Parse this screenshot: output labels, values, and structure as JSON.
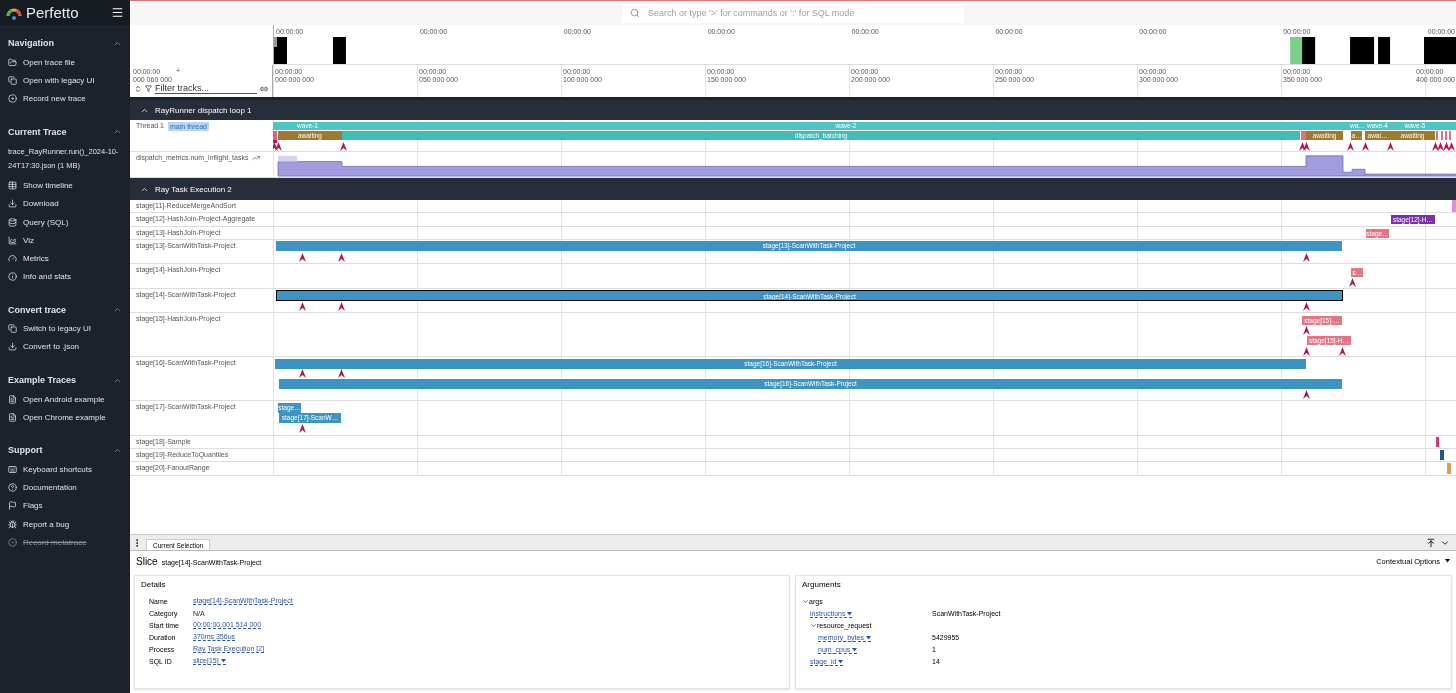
{
  "sidebar": {
    "brand": "Perfetto",
    "trace_file": "trace_RayRunner.run()_2024-10-24T17:30.json (1 MB)",
    "sections": [
      {
        "title": "Navigation",
        "expanded": true,
        "items": [
          {
            "label": "Open trace file",
            "disabled": false
          },
          {
            "label": "Open with legacy UI",
            "disabled": false
          },
          {
            "label": "Record new trace",
            "disabled": false
          }
        ]
      },
      {
        "title": "Current Trace",
        "expanded": true,
        "items": [
          {
            "label": "Show timeline",
            "disabled": false
          },
          {
            "label": "Download",
            "disabled": false
          },
          {
            "label": "Query (SQL)",
            "disabled": false
          },
          {
            "label": "Viz",
            "disabled": false
          },
          {
            "label": "Metrics",
            "disabled": false
          },
          {
            "label": "Info and stats",
            "disabled": false
          }
        ]
      },
      {
        "title": "Convert trace",
        "expanded": true,
        "items": [
          {
            "label": "Switch to legacy UI",
            "disabled": false
          },
          {
            "label": "Convert to .json",
            "disabled": false
          }
        ]
      },
      {
        "title": "Example Traces",
        "expanded": true,
        "items": [
          {
            "label": "Open Android example",
            "disabled": false
          },
          {
            "label": "Open Chrome example",
            "disabled": false
          }
        ]
      },
      {
        "title": "Support",
        "expanded": true,
        "items": [
          {
            "label": "Keyboard shortcuts",
            "disabled": false
          },
          {
            "label": "Documentation",
            "disabled": false
          },
          {
            "label": "Flags",
            "disabled": false
          },
          {
            "label": "Report a bug",
            "disabled": false
          },
          {
            "label": "Record metatrace",
            "disabled": true
          }
        ]
      }
    ]
  },
  "search": {
    "placeholder": "Search or type '>' for commands or ':' for SQL mode"
  },
  "overview": {
    "tick_labels": [
      "00:00:00",
      "00:00:00",
      "00:00:00",
      "00:00:00",
      "00:00:00",
      "00:00:00",
      "00:00:00",
      "00:00:00",
      "00:00:00"
    ]
  },
  "ruler": {
    "origin": [
      "00:00:00",
      "000 060 000"
    ],
    "origin_mark": "+",
    "ticks": [
      {
        "time": "00:00:00",
        "offset": "000 000 000"
      },
      {
        "time": "00:00:00",
        "offset": "050 000 000"
      },
      {
        "time": "00:00:00",
        "offset": "100 000 000"
      },
      {
        "time": "00:00:00",
        "offset": "150 000 000"
      },
      {
        "time": "00:00:00",
        "offset": "200 000 000"
      },
      {
        "time": "00:00:00",
        "offset": "250 000 000"
      },
      {
        "time": "00:00:00",
        "offset": "300 000 000"
      },
      {
        "time": "00:00:00",
        "offset": "350 000 000"
      },
      {
        "time": "00:00:00",
        "offset": "400 000 000"
      }
    ]
  },
  "filter": {
    "placeholder": "Filter tracks..."
  },
  "groups": [
    {
      "title": "RayRunner dispatch loop 1",
      "expanded": true,
      "tracks": [
        {
          "kind": "thread",
          "name": "Thread 1",
          "tag": "main thread",
          "slices": [
            {
              "label": "wave-1",
              "color": "#4fc4c4",
              "selected": false
            },
            {
              "label": "wave-2",
              "color": "#4fc4c4",
              "selected": false
            },
            {
              "label": "wa…",
              "color": "#4fc4c4",
              "selected": false
            },
            {
              "label": "wave-4",
              "color": "#4fc4c4",
              "selected": false
            },
            {
              "label": "wave-5",
              "color": "#4fc4c4",
              "selected": false
            },
            {
              "label": "awaiting",
              "color": "#9c7a30",
              "selected": false
            },
            {
              "label": "dispatch_batching",
              "color": "#41bcb6",
              "selected": false
            },
            {
              "label": "awaiting",
              "color": "#9c7a30",
              "selected": false
            },
            {
              "label": "a…",
              "color": "#9c7a30",
              "selected": false
            },
            {
              "label": "awai…",
              "color": "#9c7a30",
              "selected": false
            },
            {
              "label": "awaiting",
              "color": "#9c7a30",
              "selected": false
            }
          ]
        },
        {
          "kind": "counter",
          "name": "dispatch_metrics.num_inflight_tasks"
        }
      ]
    },
    {
      "title": "Ray Task Execution 2",
      "expanded": true,
      "tracks": [
        {
          "kind": "slices",
          "name": "stage[11]-ReduceMergeAndSort"
        },
        {
          "kind": "slices",
          "name": "stage[12]-HashJoin-Project-Aggregate",
          "slices": [
            {
              "label": "stage[12]-H…",
              "color": "#7b2fa8",
              "selected": false
            }
          ]
        },
        {
          "kind": "slices",
          "name": "stage[13]-HashJoin-Project",
          "slices": [
            {
              "label": "stage…",
              "color": "#e57480",
              "selected": false
            }
          ]
        },
        {
          "kind": "slices",
          "name": "stage[13]-ScanWithTask-Project",
          "slices": [
            {
              "label": "stage[13]-ScanWithTask-Project",
              "color": "#3b94c4",
              "selected": false
            }
          ]
        },
        {
          "kind": "slices",
          "name": "stage[14]-HashJoin-Project",
          "slices": [
            {
              "label": "s…",
              "color": "#e57480",
              "selected": false
            }
          ]
        },
        {
          "kind": "slices",
          "name": "stage[14]-ScanWithTask-Project",
          "slices": [
            {
              "label": "stage[14]-ScanWithTask-Project",
              "color": "#3b94c4",
              "selected": true
            }
          ]
        },
        {
          "kind": "slices",
          "name": "stage[15]-HashJoin-Project",
          "slices": [
            {
              "label": "stage[15]-…",
              "color": "#e57480",
              "selected": false
            },
            {
              "label": "stage[15]-H…",
              "color": "#e57480",
              "selected": false
            }
          ]
        },
        {
          "kind": "slices",
          "name": "stage[16]-ScanWithTask-Project",
          "slices": [
            {
              "label": "stage[16]-ScanWithTask-Project",
              "color": "#3b94c4",
              "selected": false
            },
            {
              "label": "stage[16]-ScanWithTask-Project",
              "color": "#3b94c4",
              "selected": false
            }
          ]
        },
        {
          "kind": "slices",
          "name": "stage[17]-ScanWithTask-Project",
          "slices": [
            {
              "label": "stage…",
              "color": "#3b94c4",
              "selected": false
            },
            {
              "label": "stage[17]-ScanW…",
              "color": "#3b94c4",
              "selected": false
            }
          ]
        },
        {
          "kind": "slices",
          "name": "stage[18]-Sample"
        },
        {
          "kind": "slices",
          "name": "stage[19]-ReduceToQuantiles"
        },
        {
          "kind": "slices",
          "name": "stage[20]-FanoutRange"
        }
      ]
    }
  ],
  "bottom": {
    "tabs": [
      {
        "label": "Current Selection",
        "selected": true
      }
    ],
    "selection": {
      "type": "Slice",
      "name": "stage[14]-ScanWithTask-Project"
    },
    "contextual": "Contextual Options",
    "details": {
      "title": "Details",
      "rows": [
        {
          "key": "Name",
          "value": "stage[14]-ScanWithTask-Project",
          "link": true,
          "menu": false
        },
        {
          "key": "Category",
          "value": "N/A",
          "link": false,
          "menu": false
        },
        {
          "key": "Start time",
          "value": "00:00:00.001 514 000",
          "link": true,
          "menu": false
        },
        {
          "key": "Duration",
          "value": "370ms 356us",
          "link": true,
          "menu": false
        },
        {
          "key": "Process",
          "value": "Ray Task Execution [2]",
          "link": true,
          "menu": false
        },
        {
          "key": "SQL ID",
          "value": "slice[15]",
          "link": true,
          "menu": true
        }
      ]
    },
    "arguments": {
      "title": "Arguments",
      "tree": [
        {
          "key": "args",
          "expanded": true,
          "children": [
            {
              "key": "instructions",
              "value": "ScanWithTask-Project"
            },
            {
              "key": "resource_request",
              "expanded": true,
              "children": [
                {
                  "key": "memory_bytes",
                  "value": "5429955"
                },
                {
                  "key": "num_cpus",
                  "value": "1"
                }
              ]
            },
            {
              "key": "stage_id",
              "value": "14"
            }
          ]
        }
      ]
    }
  }
}
